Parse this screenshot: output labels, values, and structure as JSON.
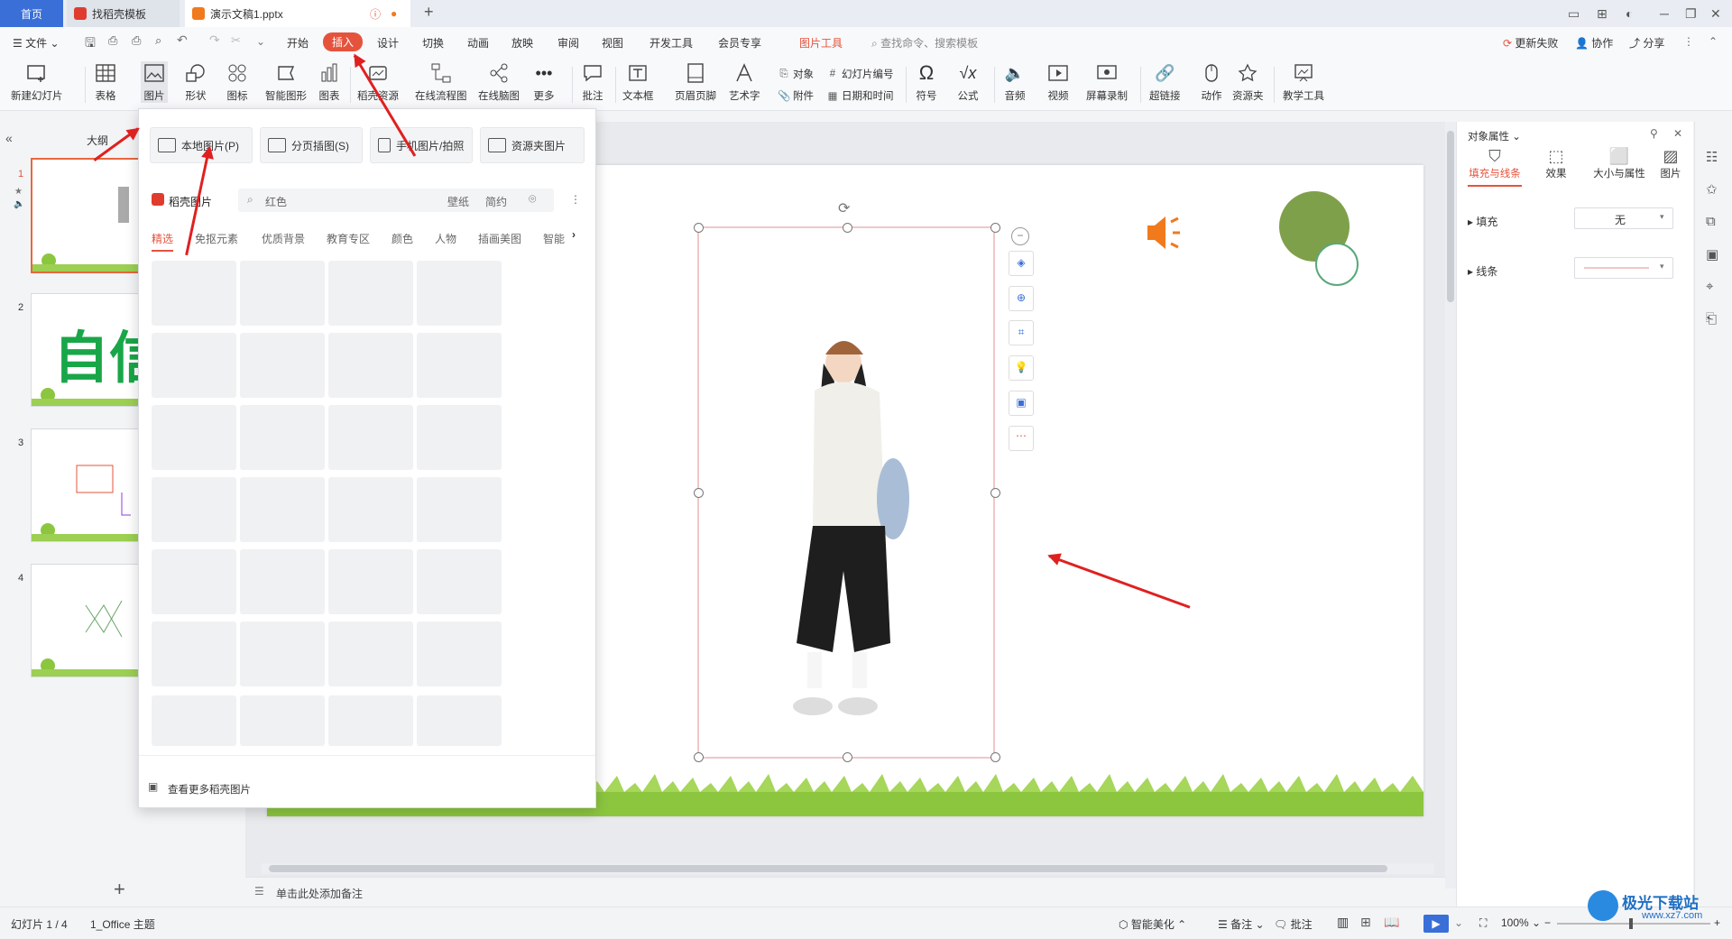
{
  "titlebar": {
    "tab_home": "首页",
    "tab_template": "找稻壳模板",
    "tab_doc": "演示文稿1.pptx"
  },
  "menubar": {
    "file": "文件",
    "items": [
      "开始",
      "插入",
      "设计",
      "切换",
      "动画",
      "放映",
      "审阅",
      "视图",
      "开发工具",
      "会员专享"
    ],
    "picture_tools": "图片工具",
    "search_placeholder": "查找命令、搜索模板",
    "update_failed": "更新失败",
    "collab": "协作",
    "share": "分享"
  },
  "ribbon": {
    "new_slide": "新建幻灯片",
    "table": "表格",
    "picture": "图片",
    "shape": "形状",
    "icon": "图标",
    "smart_shape": "智能图形",
    "chart": "图表",
    "docer_res": "稻壳资源",
    "flowchart": "在线流程图",
    "mindmap": "在线脑图",
    "more": "更多",
    "comment": "批注",
    "textbox": "文本框",
    "header_footer": "页眉页脚",
    "wordart": "艺术字",
    "object": "对象",
    "attachment": "附件",
    "slide_number": "幻灯片编号",
    "datetime": "日期和时间",
    "symbol": "符号",
    "formula": "公式",
    "audio": "音频",
    "video": "视频",
    "screen_record": "屏幕录制",
    "hyperlink": "超链接",
    "action": "动作",
    "resource_folder": "资源夹",
    "teaching_tools": "教学工具"
  },
  "leftpanel": {
    "outline": "大纲",
    "slides": [
      1,
      2,
      3,
      4
    ],
    "thumb2_text": "自信"
  },
  "popup": {
    "btn_local": "本地图片(P)",
    "btn_page": "分页插图(S)",
    "btn_phone": "手机图片/拍照",
    "btn_resfolder": "资源夹图片",
    "docer_title": "稻壳图片",
    "search_value": "红色",
    "tag_wallpaper": "壁纸",
    "tag_simple": "简约",
    "categories": [
      "精选",
      "免抠元素",
      "优质背景",
      "教育专区",
      "颜色",
      "人物",
      "插画美图",
      "智能"
    ],
    "see_more": "查看更多稻壳图片"
  },
  "rightpanel": {
    "title": "对象属性",
    "tabs": [
      "填充与线条",
      "效果",
      "大小与属性",
      "图片"
    ],
    "fill_label": "填充",
    "fill_value": "无",
    "line_label": "线条"
  },
  "canvas": {
    "notes_placeholder": "单击此处添加备注"
  },
  "statusbar": {
    "slide_info": "幻灯片 1 / 4",
    "theme": "1_Office 主题",
    "smart_beautify": "智能美化",
    "notes": "备注",
    "comments": "批注",
    "zoom": "100%"
  },
  "watermark": {
    "brand": "极光下载站",
    "url": "www.xz7.com"
  },
  "colors": {
    "accent": "#e5533d",
    "tab_active": "#3a6fd8",
    "circle_green": "#7fa04a",
    "grass": "#8cc63f"
  }
}
